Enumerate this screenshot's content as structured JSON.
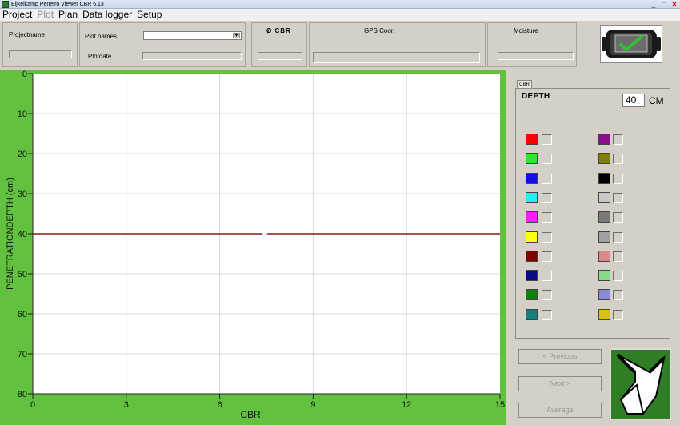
{
  "window": {
    "title": "Eijkelkamp Penetro Viewer CBR  6.13",
    "controls": [
      "_",
      "□",
      "✕"
    ]
  },
  "menu": [
    {
      "label": "Project",
      "enabled": true
    },
    {
      "label": "Plot",
      "enabled": false
    },
    {
      "label": "Plan",
      "enabled": true
    },
    {
      "label": "Data logger",
      "enabled": true
    },
    {
      "label": "Setup",
      "enabled": true
    }
  ],
  "header": {
    "projectname_label": "Projectname",
    "projectname_value": "",
    "plotnames_label": "Plot names",
    "plotnames_selected": "",
    "plotdate_label": "Plotdate",
    "plotdate_value": "",
    "cbr_label": "Ø CBR",
    "cbr_value": "",
    "gps_label": "GPS Coor.",
    "gps_value": "",
    "moisture_label": "Moisture",
    "moisture_value": ""
  },
  "chart_data": {
    "type": "line",
    "xlabel": "CBR",
    "ylabel": "PENETRATIONDEPTH (cm)",
    "xlim": [
      0,
      15
    ],
    "ylim": [
      0,
      80
    ],
    "y_inverted": true,
    "x_ticks": [
      0,
      3,
      6,
      9,
      12,
      15
    ],
    "y_ticks": [
      0,
      10,
      20,
      30,
      40,
      50,
      60,
      70,
      80
    ],
    "grid": true,
    "background": "#62c13f",
    "reference_line": {
      "y": 40,
      "color": "#8b1a1a"
    }
  },
  "right_panel": {
    "tab_label": "CBR",
    "depth_label": "DEPTH",
    "depth_value": "40",
    "depth_unit": "CM",
    "series_colors": [
      [
        "#ff0000",
        "#8b0f8b"
      ],
      [
        "#22ee22",
        "#808000"
      ],
      [
        "#1010e6",
        "#000000"
      ],
      [
        "#22f0f0",
        "#c8c8c8"
      ],
      [
        "#ff1aff",
        "#7a7a7a"
      ],
      [
        "#ffff14",
        "#a0a0a0"
      ],
      [
        "#800000",
        "#d88a8a"
      ],
      [
        "#0a0a82",
        "#88d888"
      ],
      [
        "#0d800d",
        "#8a8ad8"
      ],
      [
        "#108080",
        "#d8c010"
      ]
    ],
    "buttons": {
      "previous": "< Previous",
      "next": "Next >",
      "average": "Average"
    }
  }
}
